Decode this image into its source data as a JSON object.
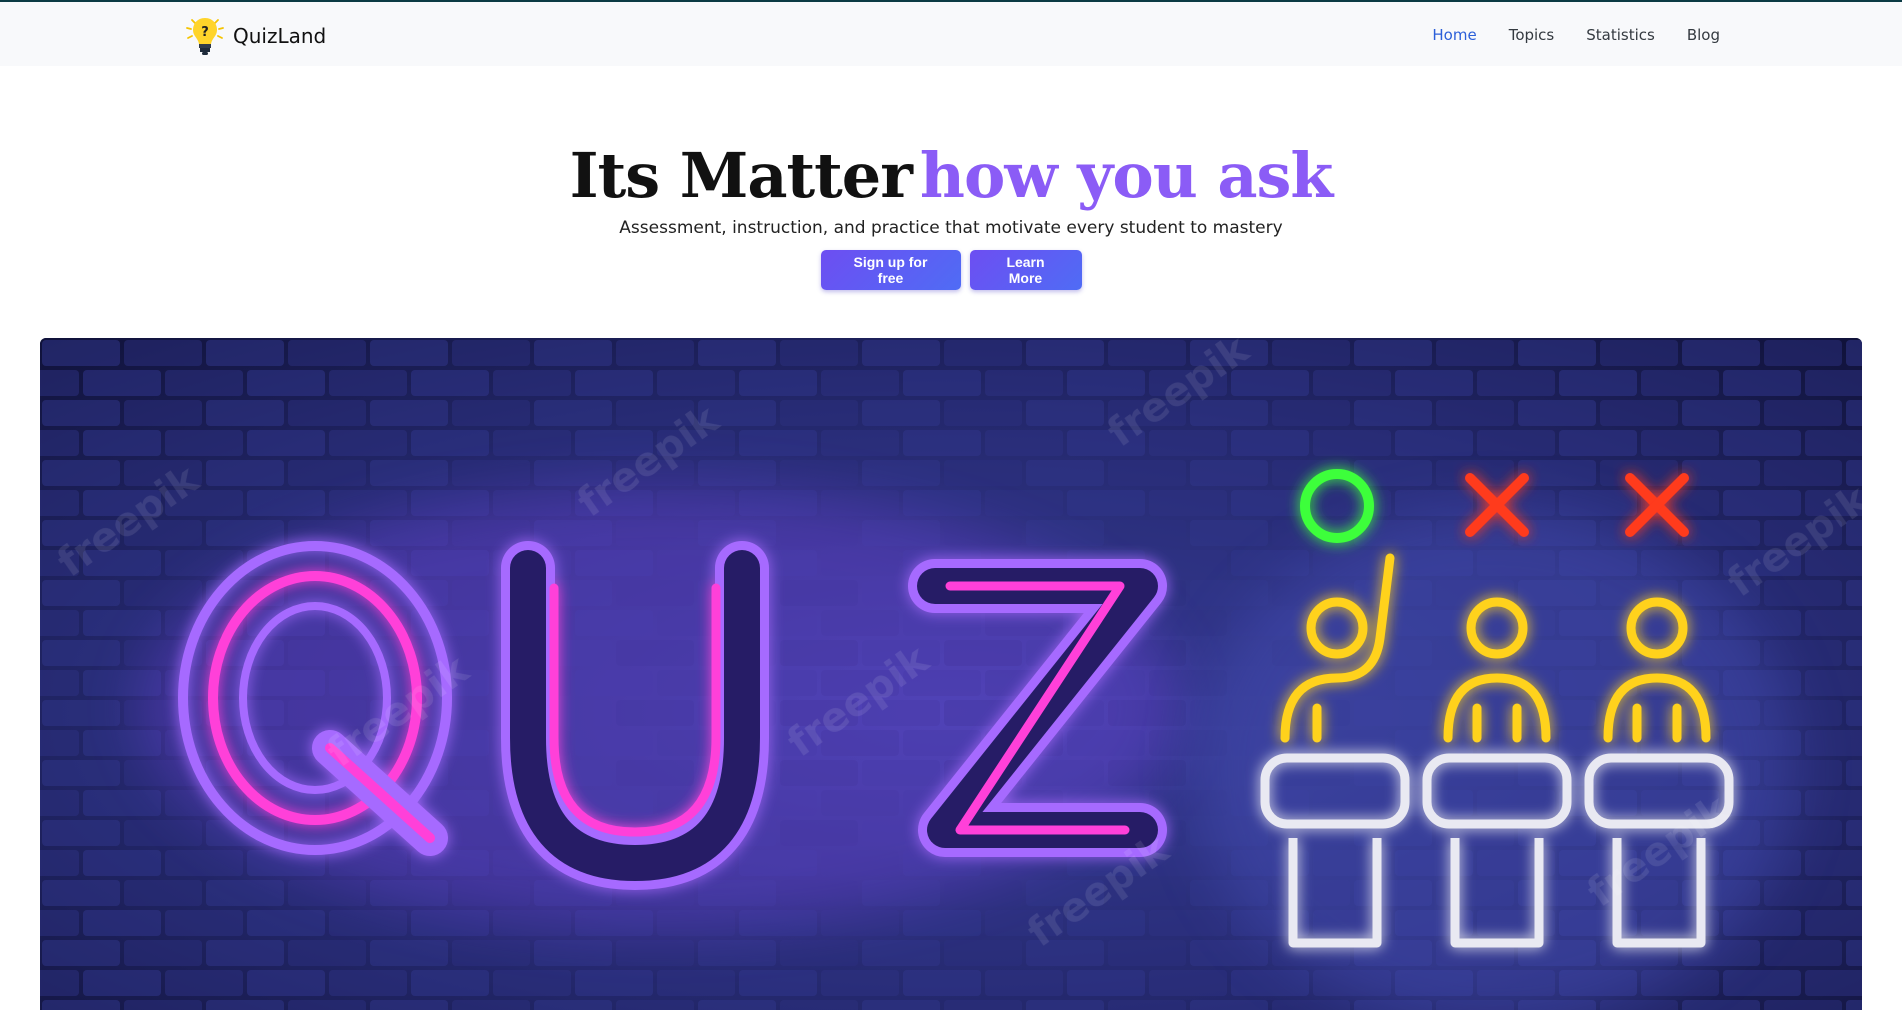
{
  "nav": {
    "brand": "QuizLand",
    "logo_icon": "lightbulb-question-icon",
    "links": [
      {
        "label": "Home",
        "active": true
      },
      {
        "label": "Topics",
        "active": false
      },
      {
        "label": "Statistics",
        "active": false
      },
      {
        "label": "Blog",
        "active": false
      }
    ]
  },
  "hero": {
    "title_plain": "Its Matter",
    "title_accent": "how you ask",
    "subtitle": "Assessment, instruction, and practice that motivate every student to mastery",
    "buttons": {
      "signup": "Sign up for free",
      "learn_more": "Learn More"
    }
  },
  "banner": {
    "word": "QUIZ",
    "watermark": "freepik",
    "image": "neon-quiz-illustration"
  },
  "colors": {
    "accent": "#8b5cf6",
    "nav_active": "#2b5fd9",
    "button": "#5b5ef4",
    "brick_wall": "#1b1e5a",
    "neon_pink": "#ff3fd9",
    "neon_purple": "#a66bff",
    "neon_yellow": "#ffd21f",
    "neon_green": "#3dff3a",
    "neon_red": "#ff3a1f"
  }
}
